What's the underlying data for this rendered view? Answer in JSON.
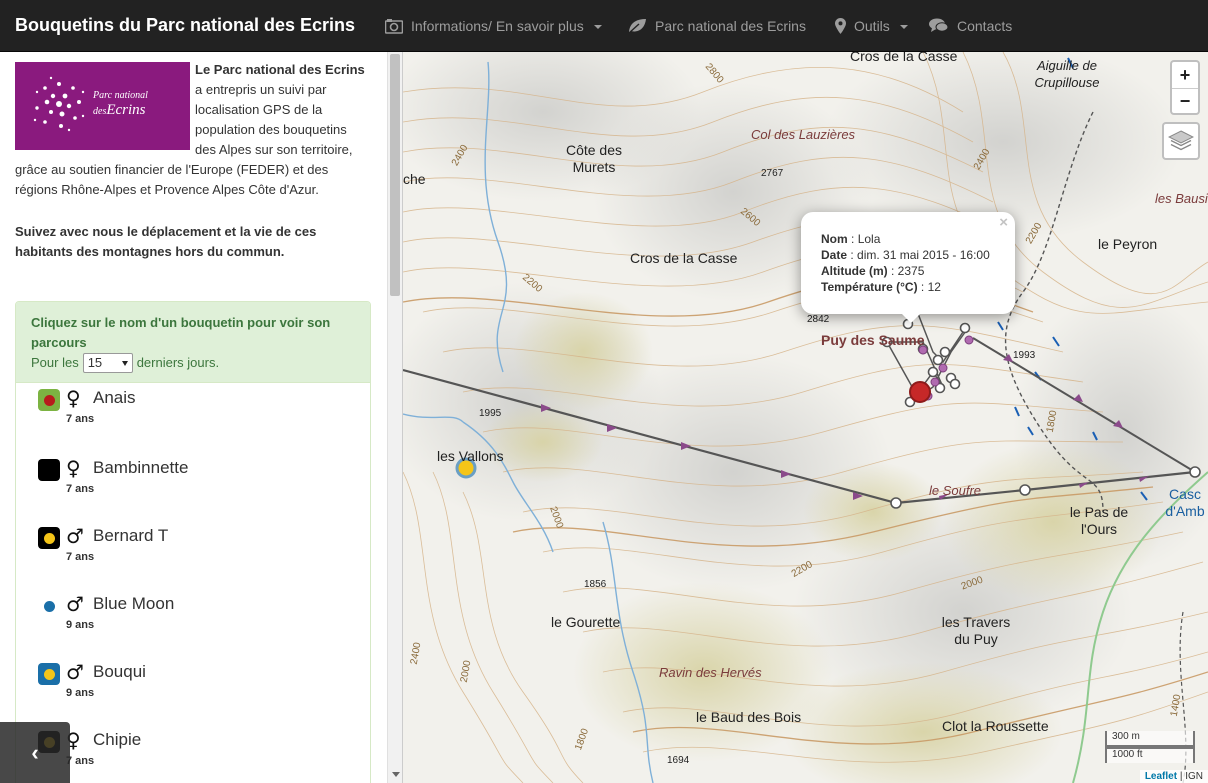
{
  "navbar": {
    "brand": "Bouquetins du Parc national des Ecrins",
    "items": [
      {
        "label": "Informations/ En savoir plus",
        "icon": "camera-icon",
        "dropdown": true
      },
      {
        "label": "Parc national des Ecrins",
        "icon": "leaf-icon",
        "dropdown": false
      },
      {
        "label": "Outils",
        "icon": "map-marker-icon",
        "dropdown": true
      },
      {
        "label": "Contacts",
        "icon": "comments-icon",
        "dropdown": false
      }
    ]
  },
  "sidebar": {
    "logo": {
      "line1": "Parc national",
      "line2_prefix": "des",
      "line2_main": "Ecrins"
    },
    "intro_bold": "Le Parc national des Ecrins",
    "intro_text": " a entrepris un suivi par localisation GPS de la population des bouquetins des Alpes sur son territoire, grâce au soutien financier de l'Europe (FEDER) et des régions Rhône-Alpes et Provence Alpes Côte d'Azur.",
    "follow_text": "Suivez avec nous le déplacement et la vie de ces habitants des montagnes hors du commun.",
    "panel": {
      "title": "Cliquez sur le nom d'un bouquetin pour voir son parcours",
      "days_prefix": "Pour les",
      "days_value": "15",
      "days_suffix": "derniers jours."
    },
    "ibex": [
      {
        "name": "Anais",
        "sex": "♀",
        "age": "7 ans",
        "bg": "#7cb342",
        "dot": "#b71c1c"
      },
      {
        "name": "Bambinnette",
        "sex": "♀",
        "age": "7 ans",
        "bg": "#000000",
        "dot": "#000000"
      },
      {
        "name": "Bernard T",
        "sex": "♂",
        "age": "7 ans",
        "bg": "#000000",
        "dot": "#f5c518"
      },
      {
        "name": "Blue Moon",
        "sex": "♂",
        "age": "9 ans",
        "bg": "transparent",
        "dot": "#1a6fa8"
      },
      {
        "name": "Bouqui",
        "sex": "♂",
        "age": "9 ans",
        "bg": "#1a6fa8",
        "dot": "#f5c518"
      },
      {
        "name": "Chipie",
        "sex": "♀",
        "age": "7 ans",
        "bg": "#000000",
        "dot": "#f5c518"
      }
    ],
    "collapse_glyph": "‹"
  },
  "map": {
    "labels": {
      "cros_casse_top": "Cros de la Casse",
      "aiguille": "Aiguille de Crupillouse",
      "col_lauzieres": "Col des Lauzières",
      "cote_murets": "Côte des Murets",
      "che": "che",
      "cros_casse_mid": "Cros de la Casse",
      "le_peyron": "le Peyron",
      "les_bausi": "les Bausi",
      "puy_saume": "Puy des Saume",
      "les_vallons": "les Vallons",
      "le_soufre": "le Soufre",
      "le_pas_ours": "le Pas de l'Ours",
      "casc": "Casc d'Amb",
      "le_gourette": "le Gourette",
      "les_travers": "les Travers du Puy",
      "ravin_herves": "Ravin des Hervés",
      "le_baud": "le Baud des Bois",
      "clot_roussette": "Clot la Roussette"
    },
    "altitudes": [
      "2800",
      "2767",
      "2400",
      "2600",
      "2200",
      "2842",
      "1993",
      "2400",
      "1995",
      "2000",
      "1856",
      "2200",
      "1800",
      "1694",
      "2400",
      "1800",
      "2000",
      "1400",
      "2200",
      "2000"
    ],
    "popup": {
      "name_label": "Nom",
      "name_value": "Lola",
      "date_label": "Date",
      "date_value": "dim. 31 mai 2015 - 16:00",
      "alt_label": "Altitude (m)",
      "alt_value": "2375",
      "temp_label": "Température (°C)",
      "temp_value": "12",
      "close": "×"
    },
    "zoom_in": "+",
    "zoom_out": "−",
    "scale_m": "300 m",
    "scale_ft": "1000 ft",
    "attribution_leaflet": "Leaflet",
    "attribution_sep": " | ",
    "attribution_ign": "IGN"
  },
  "colors": {
    "navbar_bg": "#222222",
    "panel_bg": "#dff0d8",
    "panel_text": "#3c763d",
    "track_line": "#555555",
    "track_arrow": "#8b4a8b",
    "marker_red": "#c62828"
  }
}
